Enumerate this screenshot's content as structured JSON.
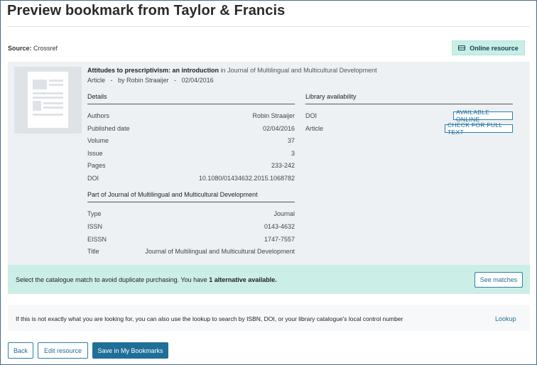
{
  "page": {
    "title": "Preview bookmark from Taylor & Francis"
  },
  "source": {
    "label": "Source:",
    "value": "Crossref"
  },
  "online_resource": {
    "label": "Online resource",
    "icon": "credit-card-icon"
  },
  "reference": {
    "title": "Attitudes to prescriptivism: an introduction",
    "journal_prefix": "in",
    "journal": "Journal of Multilingual and Multicultural Development",
    "type": "Article",
    "sep1": "-",
    "by_author": "by Robin Straaijer",
    "sep2": "-",
    "date": "02/04/2016"
  },
  "details": {
    "heading": "Details",
    "rows": [
      {
        "label": "Authors",
        "value": "Robin Straaijer"
      },
      {
        "label": "Published date",
        "value": "02/04/2016"
      },
      {
        "label": "Volume",
        "value": "37"
      },
      {
        "label": "Issue",
        "value": "3"
      },
      {
        "label": "Pages",
        "value": "233-242"
      },
      {
        "label": "DOI",
        "value": "10.1080/01434632.2015.1068782"
      }
    ]
  },
  "part_of": {
    "heading": "Part of Journal of Multilingual and Multicultural Development",
    "rows": [
      {
        "label": "Type",
        "value": "Journal"
      },
      {
        "label": "ISSN",
        "value": "0143-4632"
      },
      {
        "label": "EISSN",
        "value": "1747-7557"
      },
      {
        "label": "Title",
        "value": "Journal of Multilingual and Multicultural Development"
      }
    ]
  },
  "library": {
    "heading": "Library availability",
    "rows": [
      {
        "label": "DOI",
        "button": "AVAILABLE ONLINE"
      },
      {
        "label": "Article",
        "button": "CHECK FOR FULL TEXT"
      }
    ]
  },
  "match": {
    "text_before": "Select the catalogue match to avoid duplicate purchasing. You have",
    "text_bold": "1 alternative available.",
    "button": "See matches"
  },
  "lookup": {
    "text": "If this is not exactly what you are looking for, you can also use the lookup to search by ISBN, DOI, or your library catalogue's local control number",
    "link": "Lookup"
  },
  "footer": {
    "back": "Back",
    "edit": "Edit resource",
    "save": "Save in My Bookmarks"
  },
  "colors": {
    "primary": "#1f6f99",
    "match_bg": "#cbeee6",
    "panel_bg": "#eef1f3"
  }
}
